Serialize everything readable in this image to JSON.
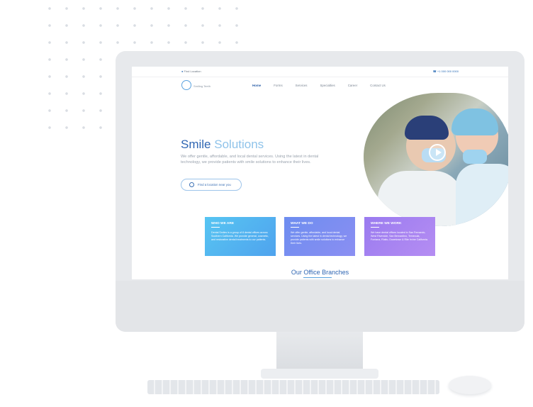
{
  "topbar": {
    "location": "Find Location",
    "phone": "+1 000 000 0000"
  },
  "nav": {
    "logo_text": "Smiling Teeth",
    "items": [
      "Home",
      "Forms",
      "Services",
      "Specialties",
      "Career",
      "Contact Us"
    ]
  },
  "hero": {
    "title_dark": "Smile",
    "title_light": "Solutions",
    "text": "We offer gentle, affordable, and local dental services. Using the latest in dental technology, we provide patients with smile solutions to enhance their lives.",
    "button": "Find a location near you"
  },
  "cards": [
    {
      "title": "WHO WE ARE",
      "text": "Dental Smiles is a group of 8 dental offices across Southern California. We provide general, cosmetic, and restorative dental treatments to our patients."
    },
    {
      "title": "WHAT WE DO",
      "text": "We offer gentle, affordable, and local dental services. Using the latest in dental technology, we provide patients with smile solutions to enhance their lives."
    },
    {
      "title": "WHERE WE WORK",
      "text": "We have dental offices located in San Fernando, West Riverside, San Bernardino, Temecula, Fontana, Rialto, Downtown & Rite Irvine California."
    }
  ],
  "section_title": "Our Office Branches",
  "icons": [
    "location-pin-icon",
    "phone-icon",
    "logo-icon",
    "location-icon",
    "play-icon"
  ],
  "colors": {
    "primary": "#2f66b3",
    "light_blue": "#8fc3ea"
  }
}
